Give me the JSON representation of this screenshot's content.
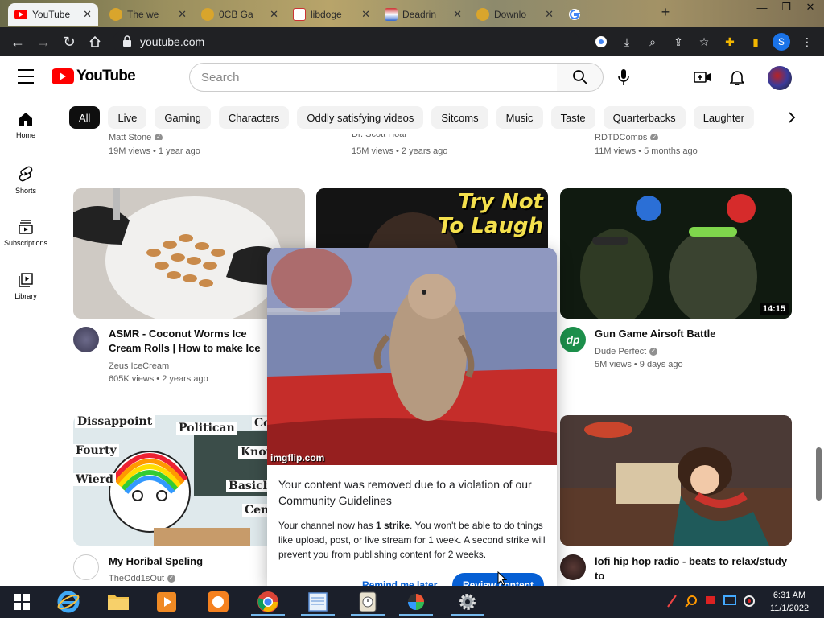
{
  "browser": {
    "tabs": [
      {
        "title": "YouTube",
        "active": true,
        "icon": "youtube-icon"
      },
      {
        "title": "The we",
        "active": false,
        "icon": "web-icon"
      },
      {
        "title": "0CB Ga",
        "active": false,
        "icon": "web-icon"
      },
      {
        "title": "libdoge",
        "active": false,
        "icon": "libdoge-icon"
      },
      {
        "title": "Deadrin",
        "active": false,
        "icon": "flag-icon"
      },
      {
        "title": "Downlo",
        "active": false,
        "icon": "download-icon"
      },
      {
        "title": "",
        "active": false,
        "icon": "google-icon"
      }
    ],
    "new_tab_label": "+",
    "url": "youtube.com"
  },
  "yt": {
    "logo_text": "YouTube",
    "search_placeholder": "Search",
    "sidebar": [
      {
        "label": "Home",
        "icon": "home-icon"
      },
      {
        "label": "Shorts",
        "icon": "shorts-icon"
      },
      {
        "label": "Subscriptions",
        "icon": "subscriptions-icon"
      },
      {
        "label": "Library",
        "icon": "library-icon"
      }
    ],
    "chips": [
      "All",
      "Live",
      "Gaming",
      "Characters",
      "Oddly satisfying videos",
      "Sitcoms",
      "Music",
      "Taste",
      "Quarterbacks",
      "Laughter"
    ],
    "top_row": [
      {
        "channel": "Matt Stone",
        "meta": "19M views • 1 year ago"
      },
      {
        "channel": "Dr. Scott Hoar",
        "meta": "15M views • 2 years ago"
      },
      {
        "channel": "RDTDComps",
        "meta": "11M views • 5 months ago"
      }
    ],
    "videos": [
      {
        "title": "ASMR - Coconut Worms Ice Cream Rolls | How to make Ice Cream out",
        "channel": "Zeus IceCream",
        "meta": "605K views • 2 years ago"
      },
      {
        "thumb_text_1": "Try Not",
        "thumb_text_2": "To Laugh"
      },
      {
        "title": "Gun Game Airsoft Battle",
        "channel": "Dude Perfect",
        "meta": "5M views • 9 days ago",
        "duration": "14:15"
      },
      {
        "title": "My Horibal Speling",
        "channel": "TheOdd1sOut",
        "thumb_words": [
          "Dissappoint",
          "Politican",
          "Co",
          "Fourty",
          "Knou",
          "Wierd",
          "Basicly",
          "Cem"
        ]
      },
      {
        "title": "lofi hip hop radio - beats to relax/study to"
      }
    ]
  },
  "modal": {
    "watermark": "imgflip.com",
    "heading": "Your content was removed due to a violation of our Community Guidelines",
    "body_prefix": "Your channel now has ",
    "body_bold": "1 strike",
    "body_suffix": ". You won't be able to do things like upload, post, or live stream for 1 week. A second strike will prevent you from publishing content for 2 weeks.",
    "remind_label": "Remind me later",
    "review_label": "Review content"
  },
  "taskbar": {
    "time": "6:31 AM",
    "date": "11/1/2022"
  }
}
